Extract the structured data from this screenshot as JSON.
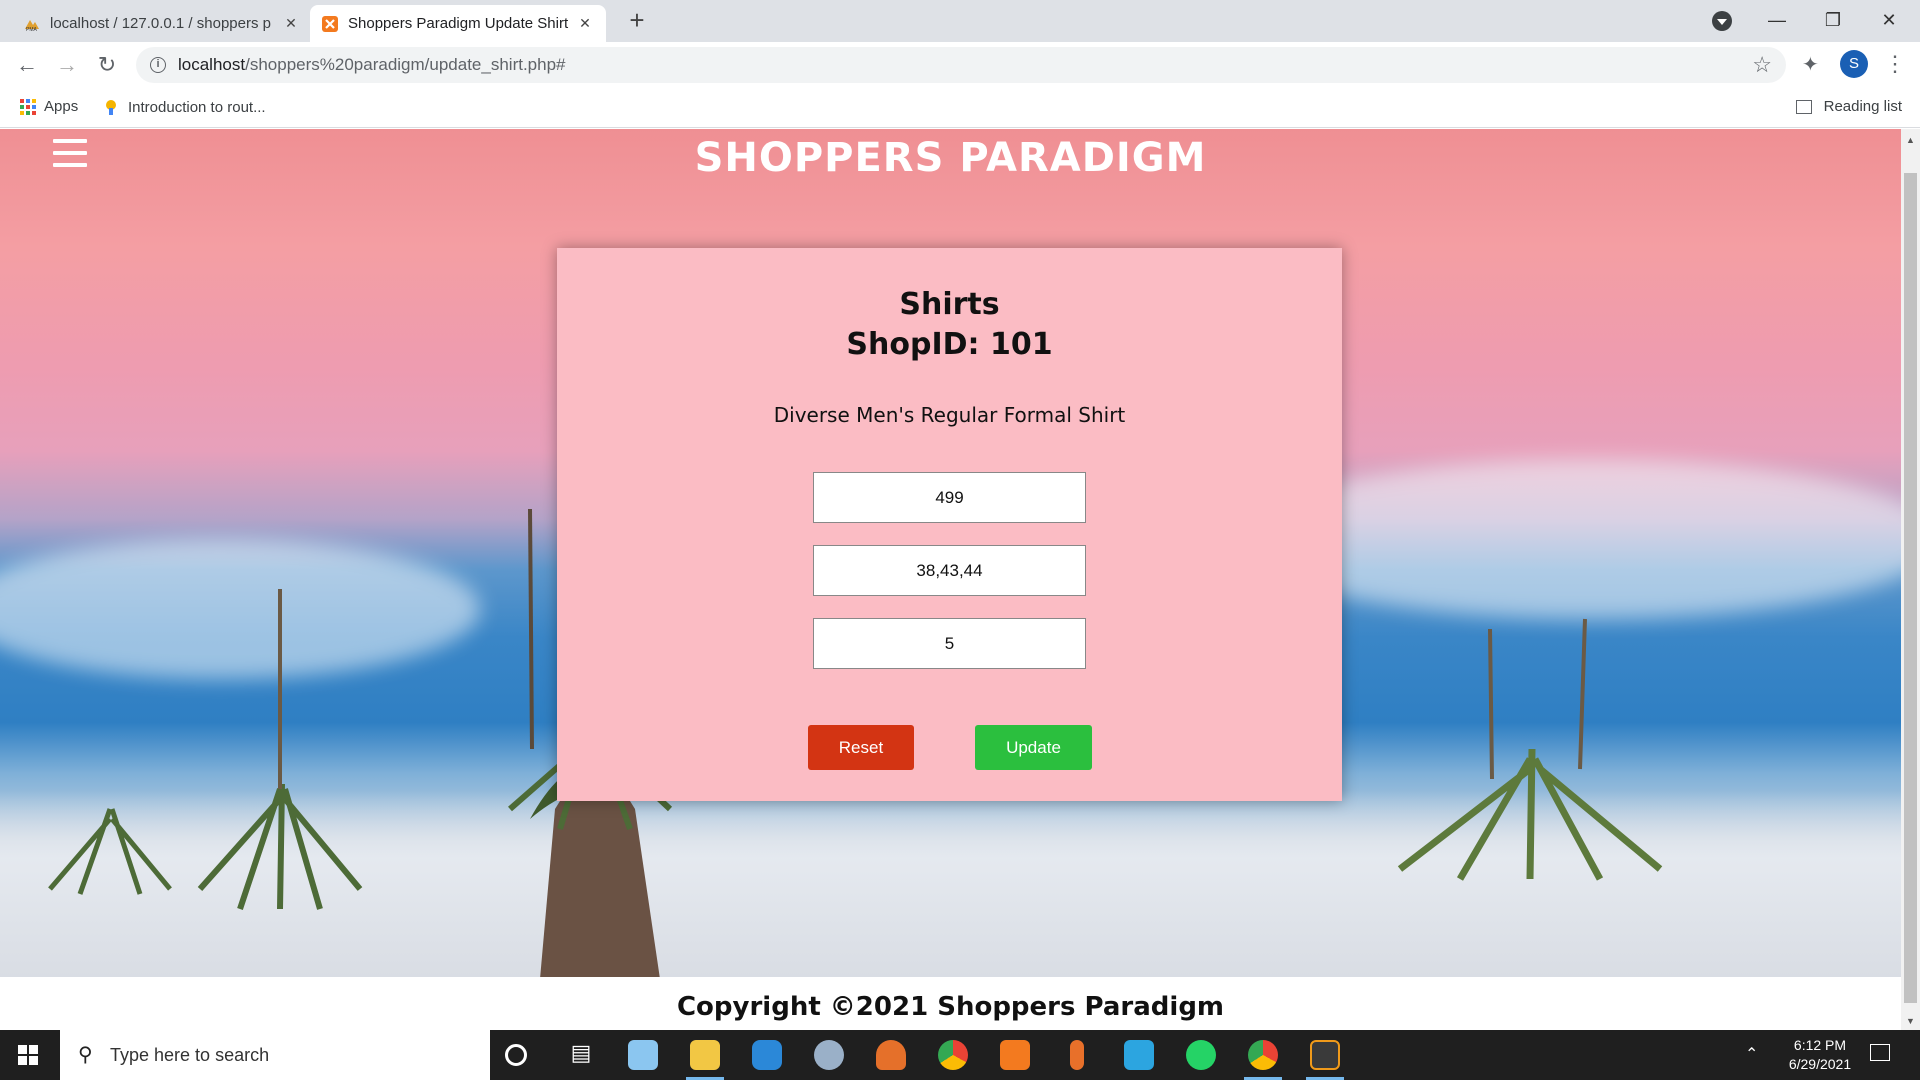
{
  "browser": {
    "tabs": [
      {
        "title": "localhost / 127.0.0.1 / shoppers p",
        "active": false
      },
      {
        "title": "Shoppers Paradigm Update Shirt",
        "active": true
      }
    ],
    "new_tab": "+",
    "url_host": "localhost",
    "url_path": "/shoppers%20paradigm/update_shirt.php#",
    "profile_initial": "S",
    "bookmarks": [
      {
        "label": "Apps"
      },
      {
        "label": "Introduction to rout..."
      }
    ],
    "reading_list": "Reading list"
  },
  "page": {
    "site_title": "SHOPPERS PARADIGM",
    "card": {
      "title": "Shirts",
      "shop_line": "ShopID: 101",
      "product_name": "Diverse Men's Regular Formal Shirt",
      "fields": {
        "price": "499",
        "sizes": "38,43,44",
        "quantity": "5"
      },
      "reset_label": "Reset",
      "update_label": "Update"
    },
    "footer": "Copyright ©2021 Shoppers Paradigm"
  },
  "taskbar": {
    "search_placeholder": "Type here to search",
    "time": "6:12 PM",
    "date": "6/29/2021"
  },
  "colors": {
    "card_bg": "#fbbcc4",
    "reset": "#d33413",
    "update": "#2bbf3e"
  }
}
